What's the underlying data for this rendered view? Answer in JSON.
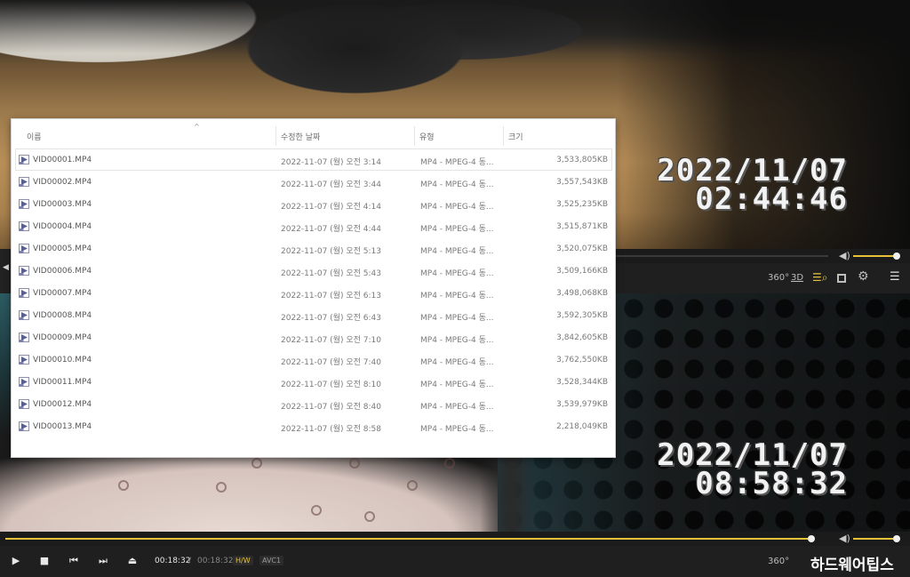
{
  "top_player": {
    "osd_date": "2022/11/07",
    "osd_time": "02:44:46",
    "toolbar": {
      "vr_label": "360°",
      "3d_label": "3D"
    },
    "volume_fraction": 0.85
  },
  "bottom_player": {
    "osd_date": "2022/11/07",
    "osd_time": "08:58:32",
    "current_time": "00:18:32",
    "time_separator": "/",
    "total_time": "00:18:32",
    "hw_badge": "H/W",
    "codec_badge": "AVC1",
    "vr_label": "360°",
    "progress_fraction": 0.98,
    "volume_fraction": 0.85,
    "watermark": "하드웨어팁스"
  },
  "explorer": {
    "columns": {
      "name": "이름",
      "date": "수정한 날짜",
      "type": "유형",
      "size": "크기"
    },
    "sort_indicator": "^",
    "icon": "video-file-icon",
    "files": [
      {
        "name": "VID00001.MP4",
        "date": "2022-11-07 (월) 오전 3:14",
        "type": "MP4 - MPEG-4 동...",
        "size": "3,533,805KB"
      },
      {
        "name": "VID00002.MP4",
        "date": "2022-11-07 (월) 오전 3:44",
        "type": "MP4 - MPEG-4 동...",
        "size": "3,557,543KB"
      },
      {
        "name": "VID00003.MP4",
        "date": "2022-11-07 (월) 오전 4:14",
        "type": "MP4 - MPEG-4 동...",
        "size": "3,525,235KB"
      },
      {
        "name": "VID00004.MP4",
        "date": "2022-11-07 (월) 오전 4:44",
        "type": "MP4 - MPEG-4 동...",
        "size": "3,515,871KB"
      },
      {
        "name": "VID00005.MP4",
        "date": "2022-11-07 (월) 오전 5:13",
        "type": "MP4 - MPEG-4 동...",
        "size": "3,520,075KB"
      },
      {
        "name": "VID00006.MP4",
        "date": "2022-11-07 (월) 오전 5:43",
        "type": "MP4 - MPEG-4 동...",
        "size": "3,509,166KB"
      },
      {
        "name": "VID00007.MP4",
        "date": "2022-11-07 (월) 오전 6:13",
        "type": "MP4 - MPEG-4 동...",
        "size": "3,498,068KB"
      },
      {
        "name": "VID00008.MP4",
        "date": "2022-11-07 (월) 오전 6:43",
        "type": "MP4 - MPEG-4 동...",
        "size": "3,592,305KB"
      },
      {
        "name": "VID00009.MP4",
        "date": "2022-11-07 (월) 오전 7:10",
        "type": "MP4 - MPEG-4 동...",
        "size": "3,842,605KB"
      },
      {
        "name": "VID00010.MP4",
        "date": "2022-11-07 (월) 오전 7:40",
        "type": "MP4 - MPEG-4 동...",
        "size": "3,762,550KB"
      },
      {
        "name": "VID00011.MP4",
        "date": "2022-11-07 (월) 오전 8:10",
        "type": "MP4 - MPEG-4 동...",
        "size": "3,528,344KB"
      },
      {
        "name": "VID00012.MP4",
        "date": "2022-11-07 (월) 오전 8:40",
        "type": "MP4 - MPEG-4 동...",
        "size": "3,539,979KB"
      },
      {
        "name": "VID00013.MP4",
        "date": "2022-11-07 (월) 오전 8:58",
        "type": "MP4 - MPEG-4 동...",
        "size": "2,218,049KB"
      }
    ]
  },
  "colors": {
    "accent": "#e6c23a",
    "toolbar_bg": "#1f1f1f",
    "panel_bg": "#ffffff"
  },
  "icons": {
    "play": "play-icon",
    "stop": "stop-icon",
    "prev": "skip-previous-icon",
    "next": "skip-next-icon",
    "eject": "eject-icon",
    "volume": "volume-icon",
    "settings": "gear-icon",
    "menu": "hamburger-menu-icon",
    "playlist_search": "playlist-search-icon",
    "capture": "capture-icon"
  }
}
